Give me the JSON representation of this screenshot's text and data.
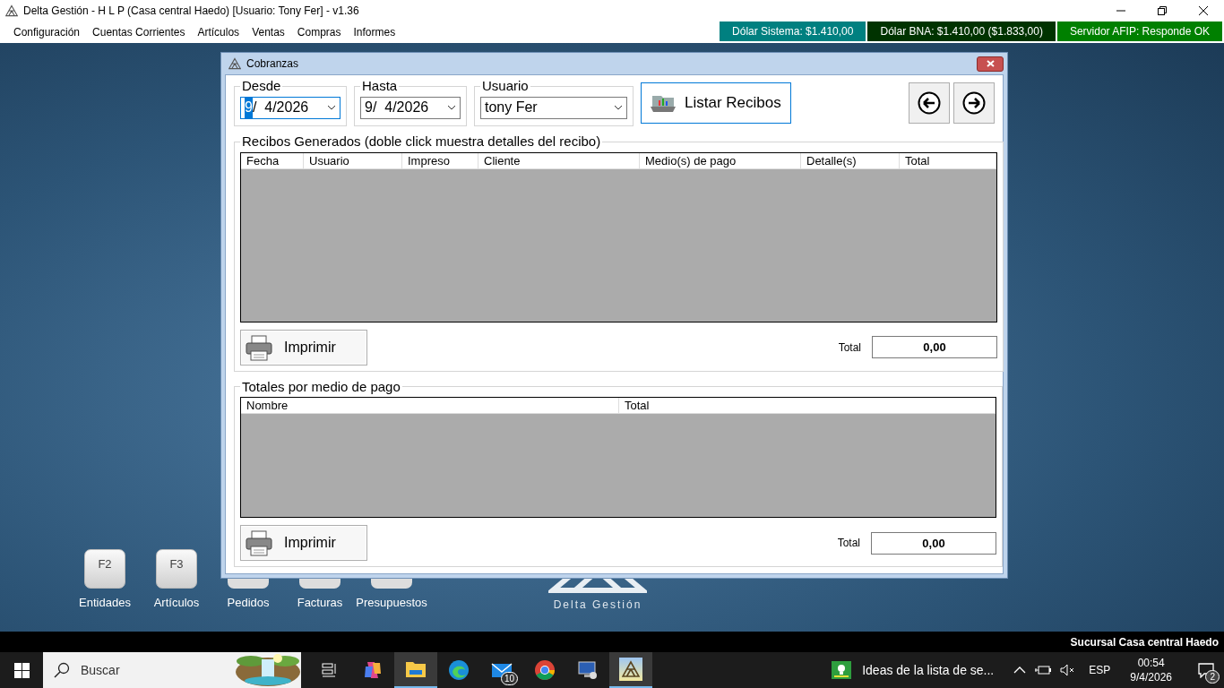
{
  "window": {
    "title": "Delta Gestión - H L P (Casa central Haedo) [Usuario: Tony Fer] - v1.36"
  },
  "menu": [
    "Configuración",
    "Cuentas Corrientes",
    "Artículos",
    "Ventas",
    "Compras",
    "Informes"
  ],
  "status_badges": [
    {
      "text": "Dólar Sistema: $1.410,00",
      "color": "#008080"
    },
    {
      "text": "Dólar BNA: $1.410,00 ($1.833,00)",
      "color": "#003300"
    },
    {
      "text": "Servidor AFIP:  Responde OK",
      "color": "#008000"
    }
  ],
  "desktop": {
    "shortcuts": [
      {
        "key": "F2",
        "label": "Entidades"
      },
      {
        "key": "F3",
        "label": "Artículos"
      },
      {
        "label": "Pedidos"
      },
      {
        "label": "Facturas"
      },
      {
        "label": "Presupuestos"
      }
    ],
    "logo_text": "Delta Gestión"
  },
  "dialog": {
    "title": "Cobranzas",
    "desde": {
      "label": "Desde",
      "day": "9",
      "rest": "/  4/2026",
      "day_selected": true
    },
    "hasta": {
      "label": "Hasta",
      "day": "9",
      "rest": "/  4/2026",
      "day_selected": false
    },
    "usuario": {
      "label": "Usuario",
      "value": "tony Fer"
    },
    "list_button": "Listar Recibos",
    "receipts": {
      "title": "Recibos Generados (doble click muestra detalles del recibo)",
      "columns": [
        "Fecha",
        "Usuario",
        "Impreso",
        "Cliente",
        "Medio(s) de pago",
        "Detalle(s)",
        "Total"
      ],
      "print_button": "Imprimir",
      "total_label": "Total",
      "total": "0,00"
    },
    "payment_totals": {
      "title": "Totales por medio de pago",
      "columns": [
        "Nombre",
        "Total"
      ],
      "print_button": "Imprimir",
      "total_label": "Total",
      "total": "0,00"
    }
  },
  "status_bar": {
    "branch": "Sucursal Casa central Haedo"
  },
  "taskbar": {
    "search_placeholder": "Buscar",
    "apps": [
      {
        "kind": "taskview",
        "active": false
      },
      {
        "kind": "copilot",
        "active": false
      },
      {
        "kind": "files",
        "active": true
      },
      {
        "kind": "edge",
        "active": false
      },
      {
        "kind": "mail",
        "active": false,
        "badge": "10"
      },
      {
        "kind": "chrome",
        "active": false
      },
      {
        "kind": "remote",
        "active": false
      },
      {
        "kind": "delta",
        "active": true
      }
    ],
    "widget": "Ideas de la lista de se...",
    "language": "ESP",
    "time": "00:54",
    "date": "9/4/2026",
    "notifications": "2"
  }
}
